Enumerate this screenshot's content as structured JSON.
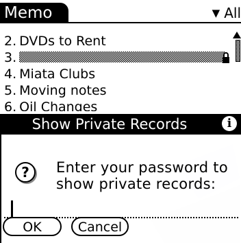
{
  "app": {
    "title": "Memo"
  },
  "category": {
    "label": "All"
  },
  "memos": [
    {
      "num": "2.",
      "title": "DVDs to Rent"
    },
    {
      "num": "3.",
      "title": ""
    },
    {
      "num": "4.",
      "title": "Miata Clubs"
    },
    {
      "num": "5.",
      "title": "Moving notes"
    },
    {
      "num": "6.",
      "title": "Oil Changes"
    }
  ],
  "dialog": {
    "title": "Show Private Records",
    "prompt_line1": "Enter your password to",
    "prompt_line2": "show private records:",
    "password_value": "",
    "ok_label": "OK",
    "cancel_label": "Cancel"
  },
  "colors": {
    "accent": "#000000",
    "background": "#ffffff"
  },
  "icons": {
    "dropdown": "triangle-down-icon",
    "lock": "lock-icon",
    "info": "info-icon",
    "question": "question-icon",
    "scroll": "scroll-up-arrow-icon"
  }
}
